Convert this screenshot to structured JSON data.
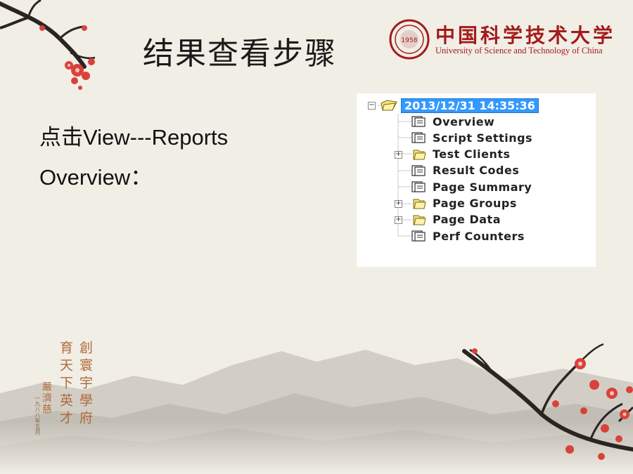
{
  "slide": {
    "title": "结果查看步骤",
    "line1": "点击View---Reports",
    "line2": "Overview："
  },
  "logo": {
    "name_cn": "中国科学技术大学",
    "name_en": "University of Science and Technology of China",
    "seal_year": "1958"
  },
  "tree": {
    "root": "2013/12/31 14:35:36",
    "items": [
      {
        "label": "Overview",
        "icon": "report-icon",
        "expandable": false
      },
      {
        "label": "Script Settings",
        "icon": "report-icon",
        "expandable": false
      },
      {
        "label": "Test Clients",
        "icon": "folder-icon",
        "expandable": true
      },
      {
        "label": "Result Codes",
        "icon": "report-icon",
        "expandable": false
      },
      {
        "label": "Page Summary",
        "icon": "report-icon",
        "expandable": false
      },
      {
        "label": "Page Groups",
        "icon": "folder-icon",
        "expandable": true
      },
      {
        "label": "Page Data",
        "icon": "folder-icon",
        "expandable": true
      },
      {
        "label": "Perf Counters",
        "icon": "report-icon",
        "expandable": false
      }
    ]
  },
  "calligraphy": {
    "col1": "創寰宇學府",
    "col2": "育天下英才",
    "signature": "嚴濟慈",
    "date": "一九八八年五月"
  },
  "colors": {
    "background": "#f1eee6",
    "brand_red": "#a31b1b",
    "selection": "#3399ff",
    "blossom": "#d9423a"
  }
}
